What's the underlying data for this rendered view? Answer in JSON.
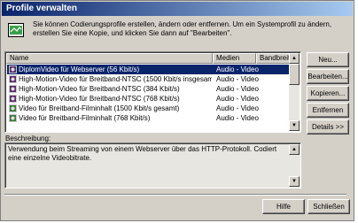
{
  "window": {
    "title": "Profile verwalten"
  },
  "intro": {
    "text": "Sie können Codierungsprofile erstellen, ändern oder entfernen. Um ein Systemprofil zu ändern, erstellen Sie eine Kopie, und klicken Sie dann auf \"Bearbeiten\"."
  },
  "list": {
    "columns": [
      "Name",
      "Medien",
      "Bandbreite zu"
    ],
    "rows": [
      {
        "name": "DiplomVideo für Webserver (56 Kbit/s)",
        "media": "Audio - Video",
        "selected": true
      },
      {
        "name": "High-Motion-Video für Breitband-NTSC (1500 Kbit/s insgesamt)",
        "media": "Audio - Video"
      },
      {
        "name": "High-Motion-Video für Breitband-NTSC (384 Kbit/s)",
        "media": "Audio - Video"
      },
      {
        "name": "High-Motion-Video für Breitband-NTSC (768 Kbit/s)",
        "media": "Audio - Video"
      },
      {
        "name": "Video für Breitband-Filminhalt (1500 Kbit/s gesamt)",
        "media": "Audio - Video"
      },
      {
        "name": "Video für Breitband-Filminhalt (768 Kbit/s)",
        "media": "Audio - Video"
      }
    ]
  },
  "side_buttons": {
    "new": "Neu...",
    "edit": "Bearbeiten...",
    "copy": "Kopieren...",
    "remove": "Entfernen",
    "details": "Details >>"
  },
  "description": {
    "label": "Beschreibung:",
    "text": "Verwendung beim Streaming von einem Webserver über das HTTP-Protokoll. Codiert eine einzelne Videobitrate."
  },
  "footer": {
    "help": "Hilfe",
    "close": "Schließen"
  },
  "colors": {
    "title_start": "#0a246a",
    "title_end": "#a6caf0",
    "selection": "#0a246a",
    "face": "#d4d0c8"
  },
  "icons": {
    "intro": "profile-icon",
    "row": "media-profile-icon"
  }
}
